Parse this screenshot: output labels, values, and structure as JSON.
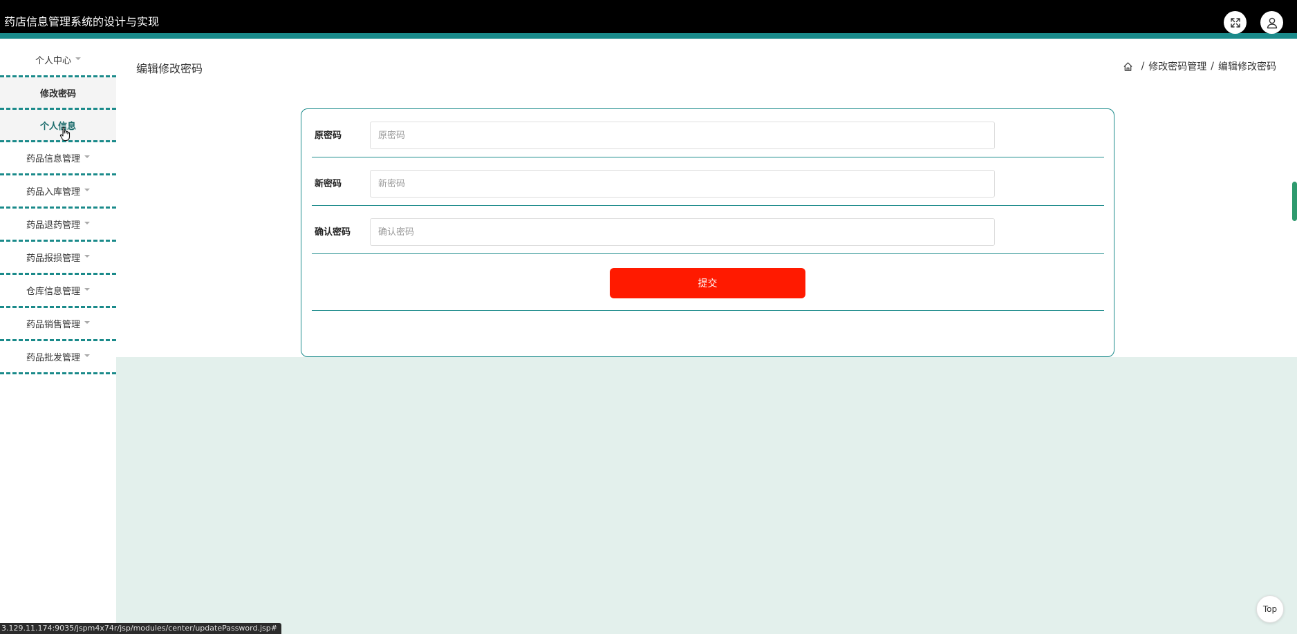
{
  "header": {
    "title": "药店信息管理系统的设计与实现",
    "fullscreen_icon": "expand-icon",
    "user_icon": "user-icon"
  },
  "sidebar": {
    "items": [
      {
        "label": "个人中心",
        "has_caret": true
      },
      {
        "label": "修改密码",
        "sub": true
      },
      {
        "label": "个人信息",
        "sub": true
      },
      {
        "label": "药品信息管理",
        "has_caret": true
      },
      {
        "label": "药品入库管理",
        "has_caret": true
      },
      {
        "label": "药品退药管理",
        "has_caret": true
      },
      {
        "label": "药品报损管理",
        "has_caret": true
      },
      {
        "label": "仓库信息管理",
        "has_caret": true
      },
      {
        "label": "药品销售管理",
        "has_caret": true
      },
      {
        "label": "药品批发管理",
        "has_caret": true
      }
    ]
  },
  "page": {
    "title": "编辑修改密码",
    "breadcrumb": [
      "修改密码管理",
      "编辑修改密码"
    ],
    "breadcrumb_sep": "/"
  },
  "form": {
    "fields": [
      {
        "label": "原密码",
        "placeholder": "原密码",
        "value": ""
      },
      {
        "label": "新密码",
        "placeholder": "新密码",
        "value": ""
      },
      {
        "label": "确认密码",
        "placeholder": "确认密码",
        "value": ""
      }
    ],
    "submit_label": "提交"
  },
  "top_button_label": "Top",
  "status_url": "3.129.11.174:9035/jspm4x74r/jsp/modules/center/updatePassword.jsp#",
  "colors": {
    "header_bg": "#000000",
    "accent": "#1a8a8a",
    "submit": "#ff1a00",
    "content_bg": "#e3f0ec"
  }
}
